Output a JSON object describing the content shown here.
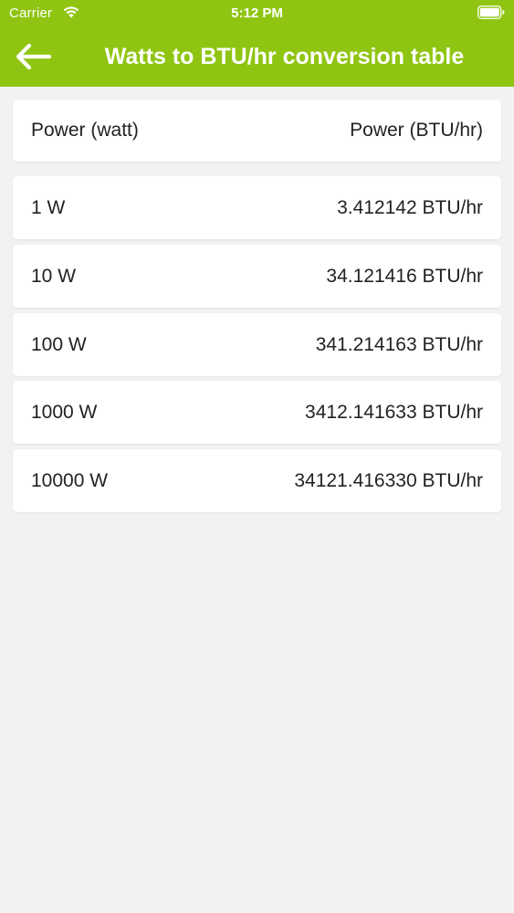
{
  "status_bar": {
    "carrier": "Carrier",
    "time": "5:12 PM"
  },
  "nav": {
    "title": "Watts to BTU/hr conversion table",
    "back_icon": "arrow-left-icon"
  },
  "table": {
    "headers": {
      "left": "Power (watt)",
      "right": "Power (BTU/hr)"
    },
    "rows": [
      {
        "watts": "1 W",
        "btu": "3.412142 BTU/hr"
      },
      {
        "watts": "10 W",
        "btu": "34.121416 BTU/hr"
      },
      {
        "watts": "100 W",
        "btu": "341.214163 BTU/hr"
      },
      {
        "watts": "1000 W",
        "btu": "3412.141633 BTU/hr"
      },
      {
        "watts": "10000 W",
        "btu": "34121.416330 BTU/hr"
      }
    ]
  },
  "colors": {
    "accent": "#8fc512",
    "background": "#f2f2f2",
    "card": "#ffffff"
  }
}
